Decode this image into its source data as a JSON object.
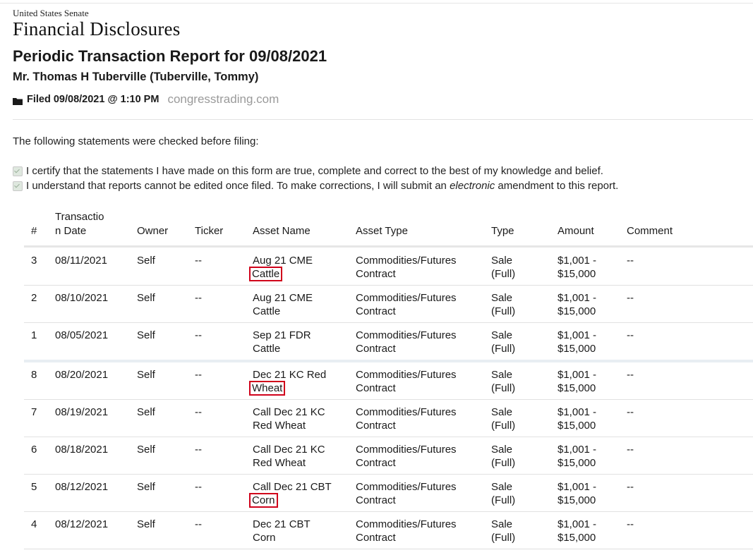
{
  "header": {
    "org": "United States Senate",
    "site_title": "Financial Disclosures",
    "report_title": "Periodic Transaction Report for 09/08/2021",
    "filer": "Mr. Thomas H Tuberville (Tuberville, Tommy)",
    "filed": "Filed 09/08/2021 @ 1:10 PM",
    "watermark": "congresstrading.com",
    "folder_icon": "folder-icon"
  },
  "statements": {
    "intro": "The following statements were checked before filing:",
    "cert1": "I certify that the statements I have made on this form are true, complete and correct to the best of my knowledge and belief.",
    "cert2_before": "I understand that reports cannot be edited once filed. To make corrections, I will submit an ",
    "cert2_em": "electronic",
    "cert2_after": " amendment to this report."
  },
  "table": {
    "headers": {
      "num": "#",
      "date": "Transactio\nn Date",
      "owner": "Owner",
      "ticker": "Ticker",
      "asset_name": "Asset Name",
      "asset_type": "Asset Type",
      "type": "Type",
      "amount": "Amount",
      "comment": "Comment"
    },
    "rows": [
      {
        "num": "3",
        "date": "08/11/2021",
        "owner": "Self",
        "ticker": "--",
        "asset_l1": "Aug 21 CME",
        "asset_l2": "Cattle",
        "atype_l1": "Commodities/Futures",
        "atype_l2": "Contract",
        "type_l1": "Sale",
        "type_l2": "(Full)",
        "amt_l1": "$1,001 -",
        "amt_l2": "$15,000",
        "comment": "--"
      },
      {
        "num": "2",
        "date": "08/10/2021",
        "owner": "Self",
        "ticker": "--",
        "asset_l1": "Aug 21 CME",
        "asset_l2": "Cattle",
        "atype_l1": "Commodities/Futures",
        "atype_l2": "Contract",
        "type_l1": "Sale",
        "type_l2": "(Full)",
        "amt_l1": "$1,001 -",
        "amt_l2": "$15,000",
        "comment": "--"
      },
      {
        "num": "1",
        "date": "08/05/2021",
        "owner": "Self",
        "ticker": "--",
        "asset_l1": "Sep 21 FDR",
        "asset_l2": "Cattle",
        "atype_l1": "Commodities/Futures",
        "atype_l2": "Contract",
        "type_l1": "Sale",
        "type_l2": "(Full)",
        "amt_l1": "$1,001 -",
        "amt_l2": "$15,000",
        "comment": "--"
      },
      {
        "num": "8",
        "date": "08/20/2021",
        "owner": "Self",
        "ticker": "--",
        "asset_l1": "Dec 21 KC Red",
        "asset_l2": "Wheat",
        "atype_l1": "Commodities/Futures",
        "atype_l2": "Contract",
        "type_l1": "Sale",
        "type_l2": "(Full)",
        "amt_l1": "$1,001 -",
        "amt_l2": "$15,000",
        "comment": "--"
      },
      {
        "num": "7",
        "date": "08/19/2021",
        "owner": "Self",
        "ticker": "--",
        "asset_l1": "Call Dec 21 KC",
        "asset_l2": "Red Wheat",
        "atype_l1": "Commodities/Futures",
        "atype_l2": "Contract",
        "type_l1": "Sale",
        "type_l2": "(Full)",
        "amt_l1": "$1,001 -",
        "amt_l2": "$15,000",
        "comment": "--"
      },
      {
        "num": "6",
        "date": "08/18/2021",
        "owner": "Self",
        "ticker": "--",
        "asset_l1": "Call Dec 21 KC",
        "asset_l2": "Red Wheat",
        "atype_l1": "Commodities/Futures",
        "atype_l2": "Contract",
        "type_l1": "Sale",
        "type_l2": "(Full)",
        "amt_l1": "$1,001 -",
        "amt_l2": "$15,000",
        "comment": "--"
      },
      {
        "num": "5",
        "date": "08/12/2021",
        "owner": "Self",
        "ticker": "--",
        "asset_l1": "Call Dec 21 CBT",
        "asset_l2": "Corn",
        "atype_l1": "Commodities/Futures",
        "atype_l2": "Contract",
        "type_l1": "Sale",
        "type_l2": "(Full)",
        "amt_l1": "$1,001 -",
        "amt_l2": "$15,000",
        "comment": "--"
      },
      {
        "num": "4",
        "date": "08/12/2021",
        "owner": "Self",
        "ticker": "--",
        "asset_l1": "Dec 21 CBT",
        "asset_l2": "Corn",
        "atype_l1": "Commodities/Futures",
        "atype_l2": "Contract",
        "type_l1": "Sale",
        "type_l2": "(Full)",
        "amt_l1": "$1,001 -",
        "amt_l2": "$15,000",
        "comment": "--"
      }
    ]
  },
  "colors": {
    "highlight": "#d0021b"
  }
}
